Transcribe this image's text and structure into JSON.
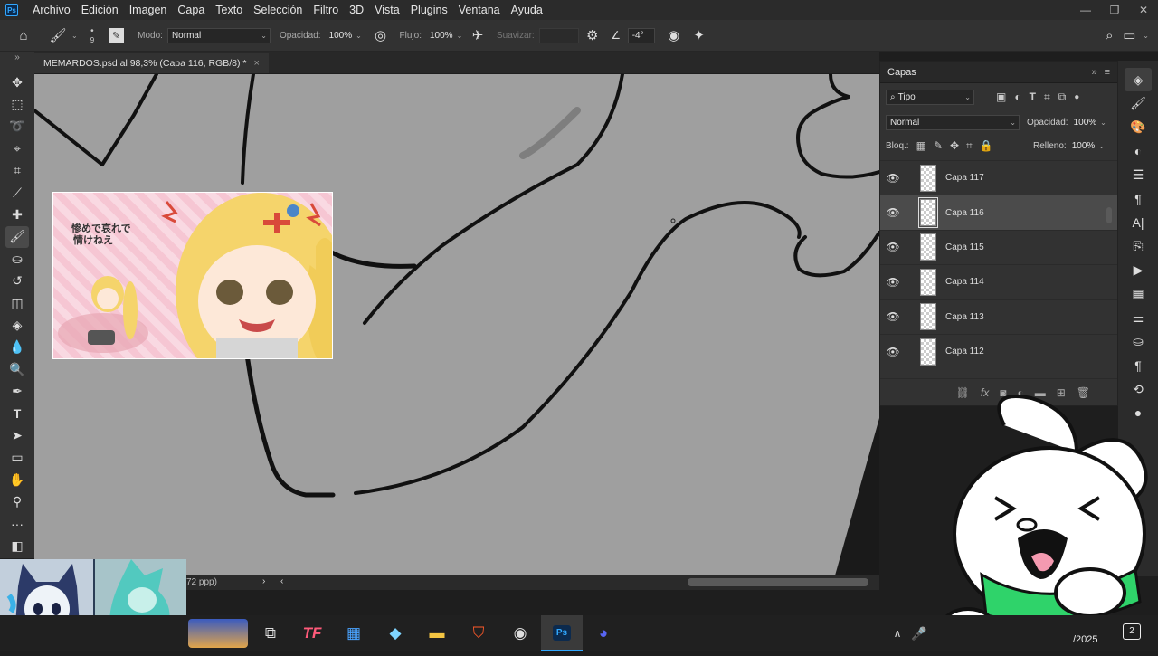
{
  "app": {
    "logo": "Ps"
  },
  "menu": [
    "Archivo",
    "Edición",
    "Imagen",
    "Capa",
    "Texto",
    "Selección",
    "Filtro",
    "3D",
    "Vista",
    "Plugins",
    "Ventana",
    "Ayuda"
  ],
  "options": {
    "brush_size": "9",
    "mode_label": "Modo:",
    "mode_value": "Normal",
    "opacity_label": "Opacidad:",
    "opacity_value": "100%",
    "flow_label": "Flujo:",
    "flow_value": "100%",
    "smoothing_label": "Suavizar:",
    "smoothing_value": "",
    "angle_value": "-4°"
  },
  "document_tab": {
    "title": "MEMARDOS.psd al 98,3% (Capa 116, RGB/8) *",
    "close": "×"
  },
  "status": {
    "text": "72 ppp)"
  },
  "reference_image": {
    "text_line1": "惨めで哀れで",
    "text_line2": "情けねえ"
  },
  "layers_panel": {
    "title": "Capas",
    "filter_label": "Tipo",
    "blend_mode": "Normal",
    "opacity_label": "Opacidad:",
    "opacity_value": "100%",
    "lock_label": "Bloq.:",
    "fill_label": "Relleno:",
    "fill_value": "100%",
    "layers": [
      {
        "name": "Capa 117",
        "selected": false
      },
      {
        "name": "Capa 116",
        "selected": true
      },
      {
        "name": "Capa 115",
        "selected": false
      },
      {
        "name": "Capa 114",
        "selected": false
      },
      {
        "name": "Capa 113",
        "selected": false
      },
      {
        "name": "Capa 112",
        "selected": false
      }
    ]
  },
  "taskbar": {
    "clock": "/2025",
    "notifications": "2"
  },
  "colors": {
    "accent": "#31a8ff",
    "canvas": "#9f9f9f",
    "mascot_bandana": "#2fd36a"
  }
}
